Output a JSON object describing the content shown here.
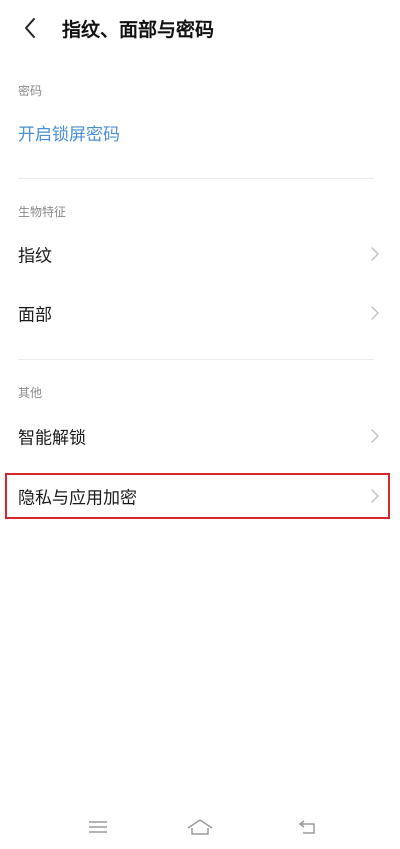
{
  "header": {
    "back_icon": "chevron-left-icon",
    "title": "指纹、面部与密码"
  },
  "sections": {
    "password": {
      "label": "密码",
      "link": "开启锁屏密码"
    },
    "biometrics": {
      "label": "生物特征",
      "items": [
        "指纹",
        "面部"
      ]
    },
    "other": {
      "label": "其他",
      "items": [
        "智能解锁",
        "隐私与应用加密"
      ]
    }
  },
  "colors": {
    "link": "#4a8fd6",
    "highlight": "#d9262c",
    "section_label": "#8a8a8a",
    "text": "#1a1a1a"
  },
  "nav_bar": {
    "menu_icon": "menu-icon",
    "home_icon": "home-icon",
    "back_icon": "back-icon"
  }
}
